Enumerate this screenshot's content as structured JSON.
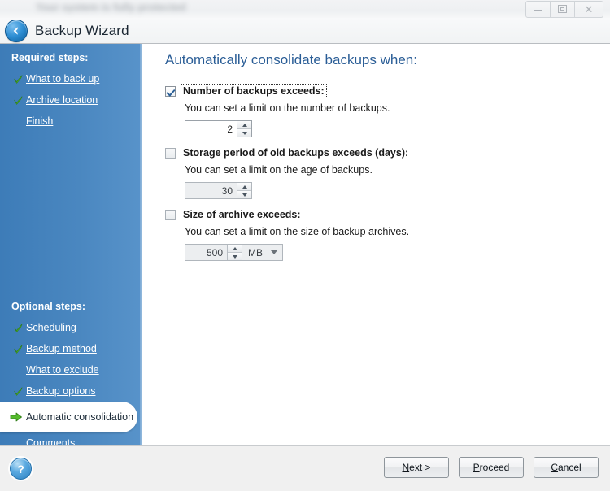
{
  "window": {
    "backdrop_text": "Your system is fully protected",
    "controls": {
      "minimize": "minimize",
      "restore": "restore",
      "close": "close"
    }
  },
  "header": {
    "back_label": "Back",
    "title": "Backup Wizard"
  },
  "sidebar": {
    "required_heading": "Required steps:",
    "required_items": [
      {
        "label": "What to back up",
        "state": "done"
      },
      {
        "label": "Archive location",
        "state": "done"
      },
      {
        "label": "Finish",
        "state": "pending"
      }
    ],
    "optional_heading": "Optional steps:",
    "optional_items": [
      {
        "label": "Scheduling",
        "state": "done"
      },
      {
        "label": "Backup method",
        "state": "done"
      },
      {
        "label": "What to exclude",
        "state": "pending"
      },
      {
        "label": "Backup options",
        "state": "done"
      },
      {
        "label": "Automatic consolidation",
        "state": "current"
      },
      {
        "label": "Comments",
        "state": "pending"
      }
    ]
  },
  "main": {
    "title": "Automatically consolidate backups when:",
    "options": [
      {
        "label": "Number of backups exceeds:",
        "description": "You can set a limit on the number of backups.",
        "checked": true,
        "value": "2",
        "unit": null
      },
      {
        "label": "Storage period of old backups exceeds (days):",
        "description": "You can set a limit on the age of backups.",
        "checked": false,
        "value": "30",
        "unit": null
      },
      {
        "label": "Size of archive exceeds:",
        "description": "You can set a limit on the size of backup archives.",
        "checked": false,
        "value": "500",
        "unit": "MB"
      }
    ]
  },
  "footer": {
    "help_label": "?",
    "buttons": {
      "next_prefix": "N",
      "next_rest": "ext >",
      "proceed_prefix": "P",
      "proceed_rest": "roceed",
      "cancel_prefix": "C",
      "cancel_rest": "ancel"
    }
  },
  "colors": {
    "sidebar_blue": "#4a87c0",
    "title_blue": "#2a5d96",
    "check_blue": "#2b5f96",
    "arrow_green": "#4aae2a"
  }
}
